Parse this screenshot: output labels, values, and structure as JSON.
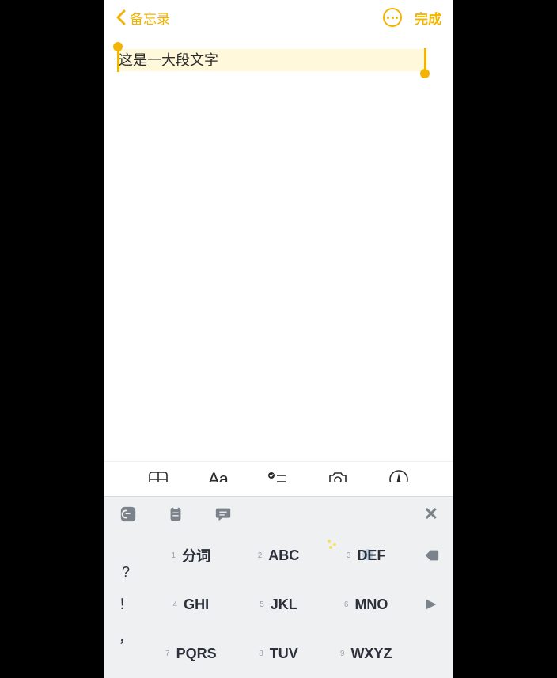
{
  "nav": {
    "back_label": "备忘录",
    "done_label": "完成"
  },
  "editor": {
    "selected_text": "这是一大段文字"
  },
  "keyboard": {
    "punct1": "?",
    "punct2": "！",
    "punct3": "，",
    "keys": {
      "k1_num": "1",
      "k1_label": "分词",
      "k2_num": "2",
      "k2_label": "ABC",
      "k3_num": "3",
      "k3_label": "DEF",
      "k4_num": "4",
      "k4_label": "GHI",
      "k5_num": "5",
      "k5_label": "JKL",
      "k6_num": "6",
      "k6_label": "MNO",
      "k7_num": "7",
      "k7_label": "PQRS",
      "k8_num": "8",
      "k8_label": "TUV",
      "k9_num": "9",
      "k9_label": "WXYZ"
    },
    "close_label": "✕"
  },
  "toolbar": {
    "aa_label": "Aa"
  }
}
